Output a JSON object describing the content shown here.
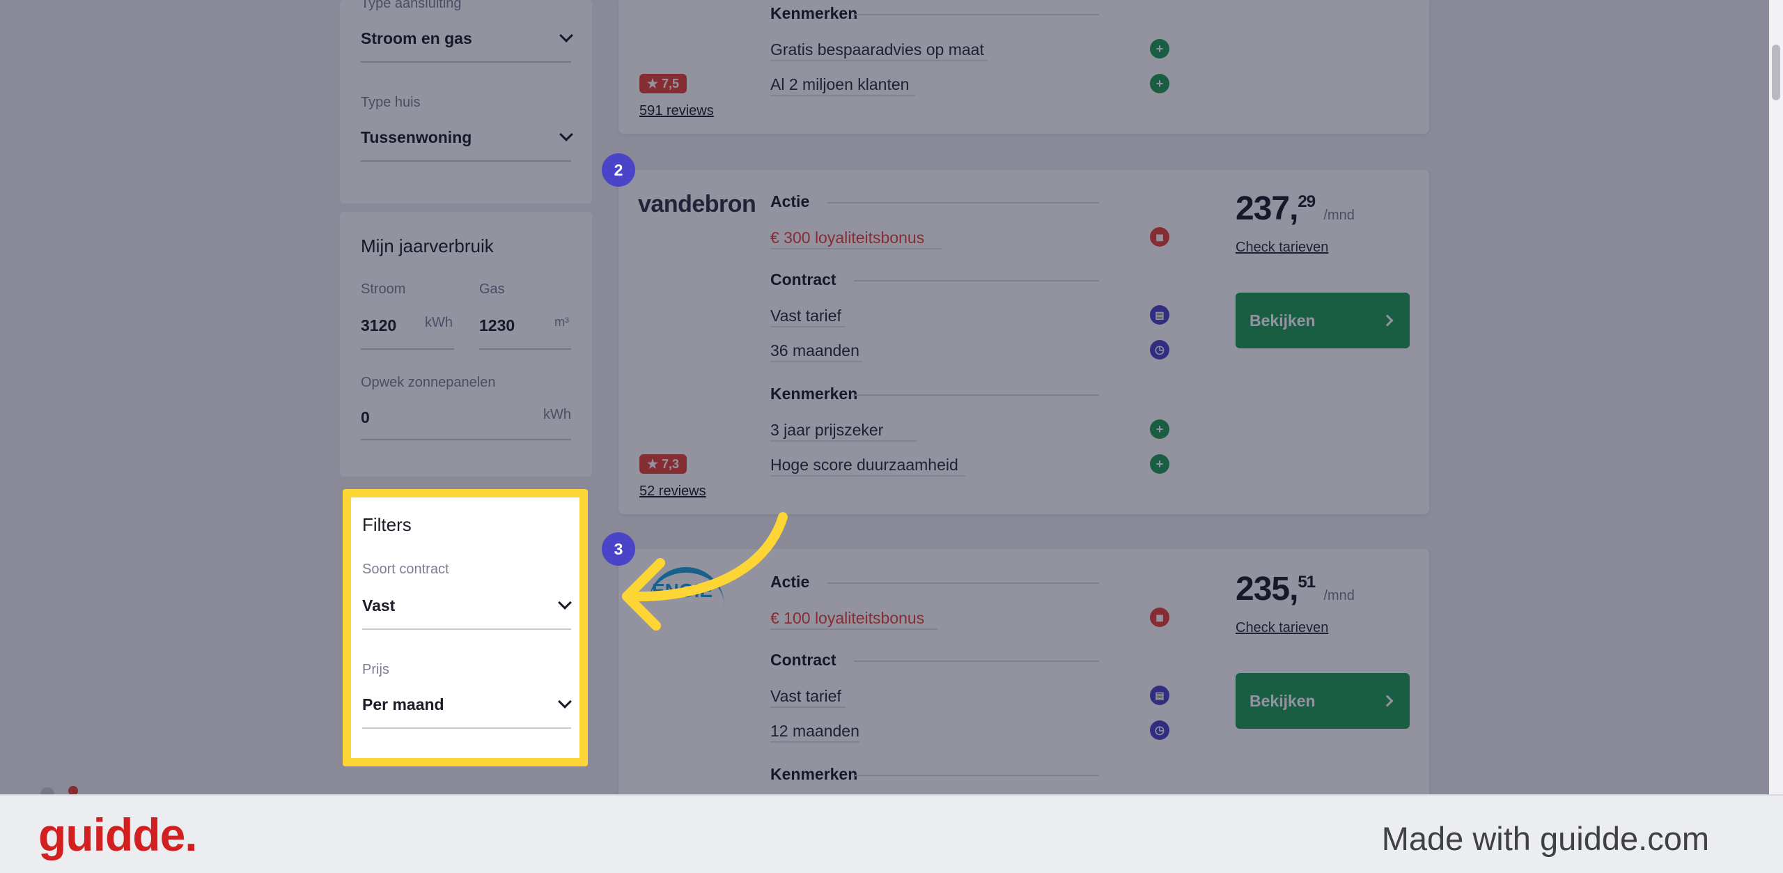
{
  "sidebar": {
    "type_aansluiting": {
      "label": "Type aansluiting",
      "value": "Stroom en gas"
    },
    "type_huis": {
      "label": "Type huis",
      "value": "Tussenwoning"
    },
    "jaarverbruik": {
      "title": "Mijn jaarverbruik",
      "stroom": {
        "label": "Stroom",
        "value": "3120",
        "unit": "kWh"
      },
      "gas": {
        "label": "Gas",
        "value": "1230",
        "unit": "m³"
      },
      "opwek": {
        "label": "Opwek zonnepanelen",
        "value": "0",
        "unit": "kWh"
      }
    },
    "filters": {
      "title": "Filters",
      "soort_contract": {
        "label": "Soort contract",
        "value": "Vast"
      },
      "prijs": {
        "label": "Prijs",
        "value": "Per maand"
      }
    }
  },
  "cards": [
    {
      "kenmerken_label": "Kenmerken",
      "kenmerken": [
        "Gratis bespaaradvies op maat",
        "Al 2 miljoen klanten"
      ],
      "rating": "7,5",
      "reviews": "591 reviews"
    },
    {
      "rank": "2",
      "provider": "vandebron",
      "actie_label": "Actie",
      "actie": "€ 300 loyaliteitsbonus",
      "contract_label": "Contract",
      "contract": [
        "Vast tarief",
        "36 maanden"
      ],
      "kenmerken_label": "Kenmerken",
      "kenmerken": [
        "3 jaar prijszeker",
        "Hoge score duurzaamheid"
      ],
      "rating": "7,3",
      "reviews": "52 reviews",
      "price_main": "237,",
      "price_cents": "29",
      "price_unit": "/mnd",
      "check": "Check tarieven",
      "button": "Bekijken"
    },
    {
      "rank": "3",
      "provider": "ENGIE",
      "actie_label": "Actie",
      "actie": "€ 100 loyaliteitsbonus",
      "contract_label": "Contract",
      "contract": [
        "Vast tarief",
        "12 maanden"
      ],
      "kenmerken_label": "Kenmerken",
      "price_main": "235,",
      "price_cents": "51",
      "price_unit": "/mnd",
      "check": "Check tarieven",
      "button": "Bekijken"
    }
  ],
  "footer": {
    "logo": "guidde.",
    "made_with": "Made with guidde.com"
  },
  "colors": {
    "accent_green": "#1f9d55",
    "accent_red": "#e8443a",
    "rank_purple": "#4a45c8",
    "highlight_yellow": "#fdd535"
  }
}
